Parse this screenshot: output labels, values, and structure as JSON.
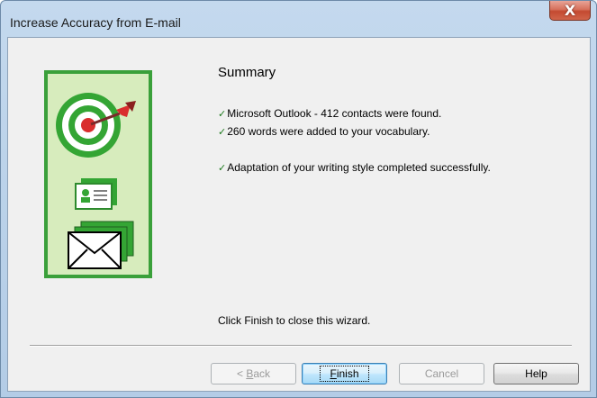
{
  "window": {
    "title": "Increase Accuracy from E-mail",
    "close_symbol": "X"
  },
  "summary": {
    "heading": "Summary",
    "items": [
      "Microsoft Outlook - 412 contacts were found.",
      "260 words were added to your vocabulary.",
      "Adaptation of your writing style completed successfully."
    ],
    "check_symbol": "✓"
  },
  "footer_text": "Click Finish to close this wizard.",
  "buttons": {
    "back": {
      "prefix": "< ",
      "mnemonic": "B",
      "rest": "ack",
      "enabled": false
    },
    "finish": {
      "mnemonic": "F",
      "rest": "inish",
      "default": true
    },
    "cancel": {
      "label": "Cancel",
      "enabled": false
    },
    "help": {
      "label": "Help"
    }
  },
  "illustration": {
    "icons": [
      "target-icon",
      "dart-icon",
      "contact-card-icon",
      "envelope-icon"
    ],
    "colors": {
      "panel_border": "#3aa03a",
      "panel_fill": "#d7ecbd",
      "target_green": "#34a534",
      "target_center": "#d92d2d"
    }
  }
}
